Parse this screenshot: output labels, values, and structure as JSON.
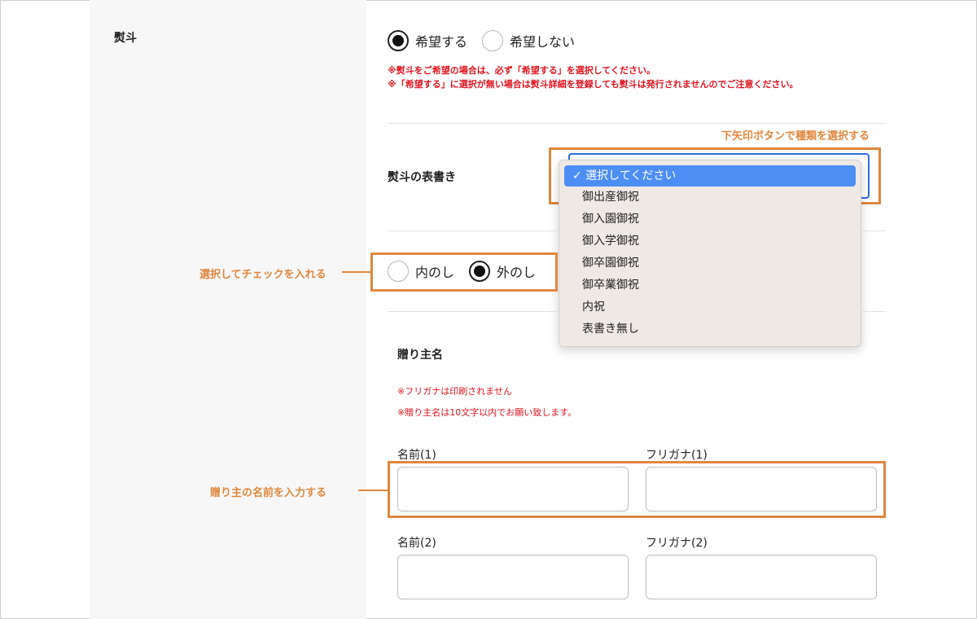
{
  "noshi": {
    "label": "熨斗",
    "options": [
      "希望する",
      "希望しない"
    ],
    "selected_index": 0,
    "notes": [
      "※熨斗をご希望の場合は、必ず「希望する」を選択してください。",
      "※「希望する」に選択が無い場合は熨斗詳細を登録しても熨斗は発行されませんのでご注意ください。"
    ]
  },
  "omotegaki": {
    "label": "熨斗の表書き",
    "hint": "下矢印ボタンで種類を選択する",
    "selected": "✓ 選択してください",
    "options": [
      "御出産御祝",
      "御入園御祝",
      "御入学御祝",
      "御卒園御祝",
      "御卒業御祝",
      "内祝",
      "表書き無し"
    ]
  },
  "wrapping": {
    "hint": "選択してチェックを入れる",
    "options": [
      "内のし",
      "外のし"
    ],
    "selected_index": 1
  },
  "sender": {
    "label": "贈り主名",
    "notes": [
      "※フリガナは印刷されません",
      "※贈り主名は10文字以内でお願い致します。"
    ],
    "hint": "贈り主の名前を入力する",
    "fields": [
      {
        "name_label": "名前(1)",
        "kana_label": "フリガナ(1)",
        "name_value": "",
        "kana_value": ""
      },
      {
        "name_label": "名前(2)",
        "kana_label": "フリガナ(2)",
        "name_value": "",
        "kana_value": ""
      }
    ]
  },
  "colors": {
    "accent_orange": "#e0873e",
    "note_red": "#e0141e",
    "select_blue": "#4d8ef5"
  }
}
